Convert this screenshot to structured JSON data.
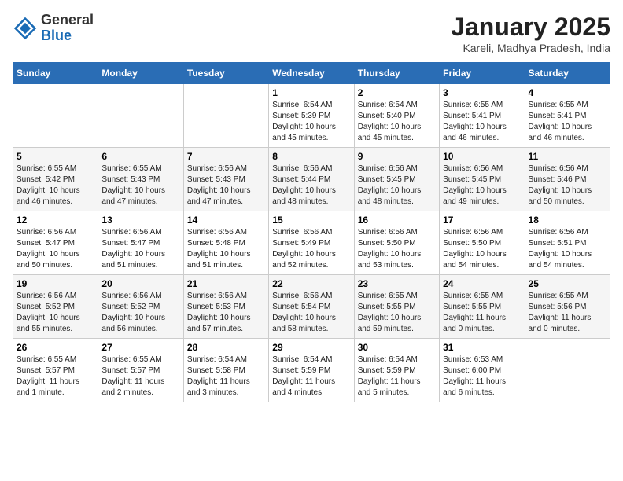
{
  "header": {
    "logo_general": "General",
    "logo_blue": "Blue",
    "month_title": "January 2025",
    "location": "Kareli, Madhya Pradesh, India"
  },
  "weekdays": [
    "Sunday",
    "Monday",
    "Tuesday",
    "Wednesday",
    "Thursday",
    "Friday",
    "Saturday"
  ],
  "weeks": [
    [
      {
        "day": "",
        "content": ""
      },
      {
        "day": "",
        "content": ""
      },
      {
        "day": "",
        "content": ""
      },
      {
        "day": "1",
        "content": "Sunrise: 6:54 AM\nSunset: 5:39 PM\nDaylight: 10 hours\nand 45 minutes."
      },
      {
        "day": "2",
        "content": "Sunrise: 6:54 AM\nSunset: 5:40 PM\nDaylight: 10 hours\nand 45 minutes."
      },
      {
        "day": "3",
        "content": "Sunrise: 6:55 AM\nSunset: 5:41 PM\nDaylight: 10 hours\nand 46 minutes."
      },
      {
        "day": "4",
        "content": "Sunrise: 6:55 AM\nSunset: 5:41 PM\nDaylight: 10 hours\nand 46 minutes."
      }
    ],
    [
      {
        "day": "5",
        "content": "Sunrise: 6:55 AM\nSunset: 5:42 PM\nDaylight: 10 hours\nand 46 minutes."
      },
      {
        "day": "6",
        "content": "Sunrise: 6:55 AM\nSunset: 5:43 PM\nDaylight: 10 hours\nand 47 minutes."
      },
      {
        "day": "7",
        "content": "Sunrise: 6:56 AM\nSunset: 5:43 PM\nDaylight: 10 hours\nand 47 minutes."
      },
      {
        "day": "8",
        "content": "Sunrise: 6:56 AM\nSunset: 5:44 PM\nDaylight: 10 hours\nand 48 minutes."
      },
      {
        "day": "9",
        "content": "Sunrise: 6:56 AM\nSunset: 5:45 PM\nDaylight: 10 hours\nand 48 minutes."
      },
      {
        "day": "10",
        "content": "Sunrise: 6:56 AM\nSunset: 5:45 PM\nDaylight: 10 hours\nand 49 minutes."
      },
      {
        "day": "11",
        "content": "Sunrise: 6:56 AM\nSunset: 5:46 PM\nDaylight: 10 hours\nand 50 minutes."
      }
    ],
    [
      {
        "day": "12",
        "content": "Sunrise: 6:56 AM\nSunset: 5:47 PM\nDaylight: 10 hours\nand 50 minutes."
      },
      {
        "day": "13",
        "content": "Sunrise: 6:56 AM\nSunset: 5:47 PM\nDaylight: 10 hours\nand 51 minutes."
      },
      {
        "day": "14",
        "content": "Sunrise: 6:56 AM\nSunset: 5:48 PM\nDaylight: 10 hours\nand 51 minutes."
      },
      {
        "day": "15",
        "content": "Sunrise: 6:56 AM\nSunset: 5:49 PM\nDaylight: 10 hours\nand 52 minutes."
      },
      {
        "day": "16",
        "content": "Sunrise: 6:56 AM\nSunset: 5:50 PM\nDaylight: 10 hours\nand 53 minutes."
      },
      {
        "day": "17",
        "content": "Sunrise: 6:56 AM\nSunset: 5:50 PM\nDaylight: 10 hours\nand 54 minutes."
      },
      {
        "day": "18",
        "content": "Sunrise: 6:56 AM\nSunset: 5:51 PM\nDaylight: 10 hours\nand 54 minutes."
      }
    ],
    [
      {
        "day": "19",
        "content": "Sunrise: 6:56 AM\nSunset: 5:52 PM\nDaylight: 10 hours\nand 55 minutes."
      },
      {
        "day": "20",
        "content": "Sunrise: 6:56 AM\nSunset: 5:52 PM\nDaylight: 10 hours\nand 56 minutes."
      },
      {
        "day": "21",
        "content": "Sunrise: 6:56 AM\nSunset: 5:53 PM\nDaylight: 10 hours\nand 57 minutes."
      },
      {
        "day": "22",
        "content": "Sunrise: 6:56 AM\nSunset: 5:54 PM\nDaylight: 10 hours\nand 58 minutes."
      },
      {
        "day": "23",
        "content": "Sunrise: 6:55 AM\nSunset: 5:55 PM\nDaylight: 10 hours\nand 59 minutes."
      },
      {
        "day": "24",
        "content": "Sunrise: 6:55 AM\nSunset: 5:55 PM\nDaylight: 11 hours\nand 0 minutes."
      },
      {
        "day": "25",
        "content": "Sunrise: 6:55 AM\nSunset: 5:56 PM\nDaylight: 11 hours\nand 0 minutes."
      }
    ],
    [
      {
        "day": "26",
        "content": "Sunrise: 6:55 AM\nSunset: 5:57 PM\nDaylight: 11 hours\nand 1 minute."
      },
      {
        "day": "27",
        "content": "Sunrise: 6:55 AM\nSunset: 5:57 PM\nDaylight: 11 hours\nand 2 minutes."
      },
      {
        "day": "28",
        "content": "Sunrise: 6:54 AM\nSunset: 5:58 PM\nDaylight: 11 hours\nand 3 minutes."
      },
      {
        "day": "29",
        "content": "Sunrise: 6:54 AM\nSunset: 5:59 PM\nDaylight: 11 hours\nand 4 minutes."
      },
      {
        "day": "30",
        "content": "Sunrise: 6:54 AM\nSunset: 5:59 PM\nDaylight: 11 hours\nand 5 minutes."
      },
      {
        "day": "31",
        "content": "Sunrise: 6:53 AM\nSunset: 6:00 PM\nDaylight: 11 hours\nand 6 minutes."
      },
      {
        "day": "",
        "content": ""
      }
    ]
  ]
}
